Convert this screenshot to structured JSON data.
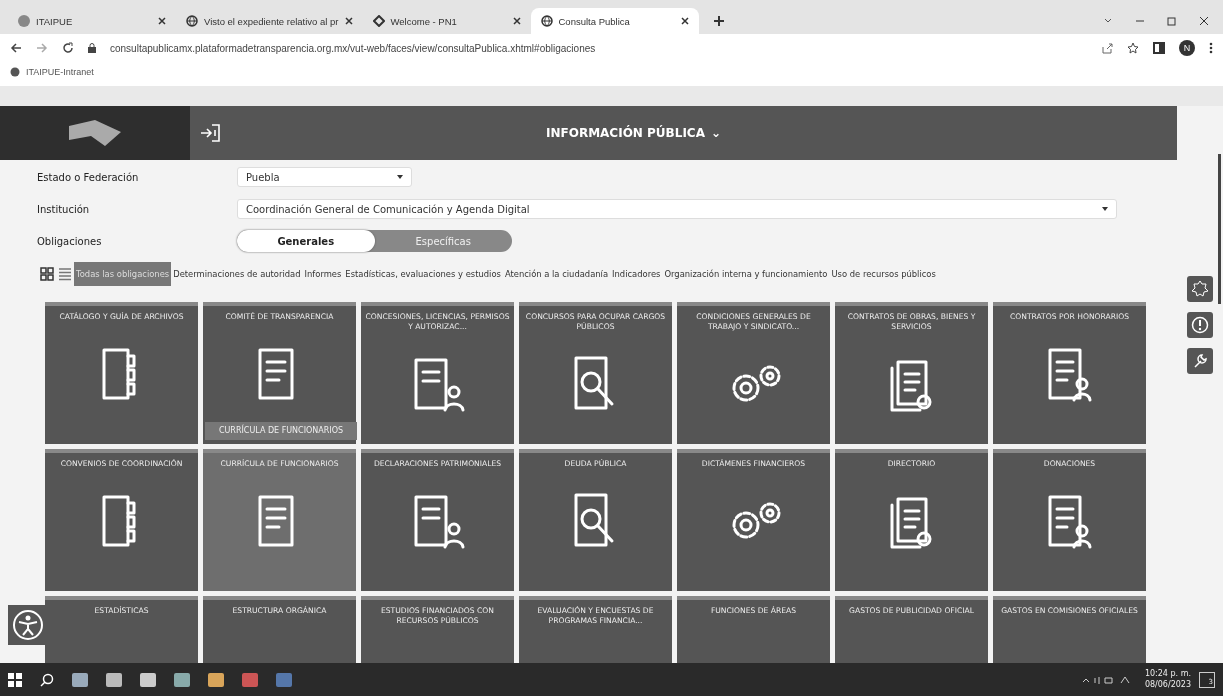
{
  "browser": {
    "tabs": [
      {
        "title": "ITAIPUE",
        "selected": false
      },
      {
        "title": "Visto el expediente relativo al pr",
        "selected": false
      },
      {
        "title": "Welcome - PN1",
        "selected": false
      },
      {
        "title": "Consulta Publica",
        "selected": true
      }
    ],
    "url": "consultapublicamx.plataformadetransparencia.org.mx/vut-web/faces/view/consultaPublica.xhtml#obligaciones",
    "bookmarks": [
      "ITAIPUE-Intranet"
    ],
    "profile_initial": "N"
  },
  "header": {
    "title": "INFORMACIÓN PÚBLICA",
    "menu_caret": "⌄"
  },
  "form": {
    "fields": [
      {
        "label": "Estado o Federación",
        "value": "Puebla",
        "wide": false
      },
      {
        "label": "Institución",
        "value": "Coordinación General de Comunicación y Agenda Digital",
        "wide": true
      }
    ],
    "obligations_label": "Obligaciones",
    "obligation_types": [
      {
        "label": "Generales",
        "selected": true
      },
      {
        "label": "Específicas",
        "selected": false
      }
    ]
  },
  "view_modes": [
    {
      "kind": "grid",
      "selected": true
    },
    {
      "kind": "list",
      "selected": false
    }
  ],
  "categories": [
    {
      "label": "Todas las obligaciones",
      "selected": true
    },
    {
      "label": "Determinaciones de autoridad",
      "selected": false
    },
    {
      "label": "Informes",
      "selected": false
    },
    {
      "label": "Estadísticas, evaluaciones y estudios",
      "selected": false
    },
    {
      "label": "Atención a la ciudadanía",
      "selected": false
    },
    {
      "label": "Indicadores",
      "selected": false
    },
    {
      "label": "Organización interna y funcionamiento",
      "selected": false
    },
    {
      "label": "Uso de recursos públicos",
      "selected": false
    }
  ],
  "tiles": [
    {
      "title": "CATÁLOGO Y GUÍA DE ARCHIVOS",
      "hovered": false
    },
    {
      "title": "COMITÉ DE TRANSPARENCIA",
      "hovered": false
    },
    {
      "title": "CONCESIONES, LICENCIAS, PERMISOS Y AUTORIZAC...",
      "hovered": false
    },
    {
      "title": "CONCURSOS PARA OCUPAR CARGOS PÚBLICOS",
      "hovered": false
    },
    {
      "title": "CONDICIONES GENERALES DE TRABAJO Y SINDICATO...",
      "hovered": false
    },
    {
      "title": "CONTRATOS DE OBRAS, BIENES Y SERVICIOS",
      "hovered": false
    },
    {
      "title": "CONTRATOS POR HONORARIOS",
      "hovered": false
    },
    {
      "title": "CONVENIOS DE COORDINACIÓN",
      "hovered": false
    },
    {
      "title": "CURRÍCULA DE FUNCIONARIOS",
      "hovered": true
    },
    {
      "title": "DECLARACIONES PATRIMONIALES",
      "hovered": false
    },
    {
      "title": "DEUDA PÚBLICA",
      "hovered": false
    },
    {
      "title": "DICTÁMENES FINANCIEROS",
      "hovered": false
    },
    {
      "title": "DIRECTORIO",
      "hovered": false
    },
    {
      "title": "DONACIONES",
      "hovered": false
    },
    {
      "title": "ESTADÍSTICAS",
      "hovered": false
    },
    {
      "title": "ESTRUCTURA ORGÁNICA",
      "hovered": false
    },
    {
      "title": "ESTUDIOS FINANCIADOS CON RECURSOS PÚBLICOS",
      "hovered": false
    },
    {
      "title": "EVALUACIÓN Y ENCUESTAS DE PROGRAMAS FINANCIA...",
      "hovered": false
    },
    {
      "title": "FUNCIONES DE ÁREAS",
      "hovered": false
    },
    {
      "title": "GASTOS DE PUBLICIDAD OFICIAL",
      "hovered": false
    },
    {
      "title": "GASTOS EN COMISIONES OFICIALES",
      "hovered": false
    }
  ],
  "tooltip": "CURRÍCULA DE FUNCIONARIOS",
  "taskbar": {
    "time": "10:24 p. m.",
    "date": "08/06/2023",
    "notification_count": "3"
  }
}
